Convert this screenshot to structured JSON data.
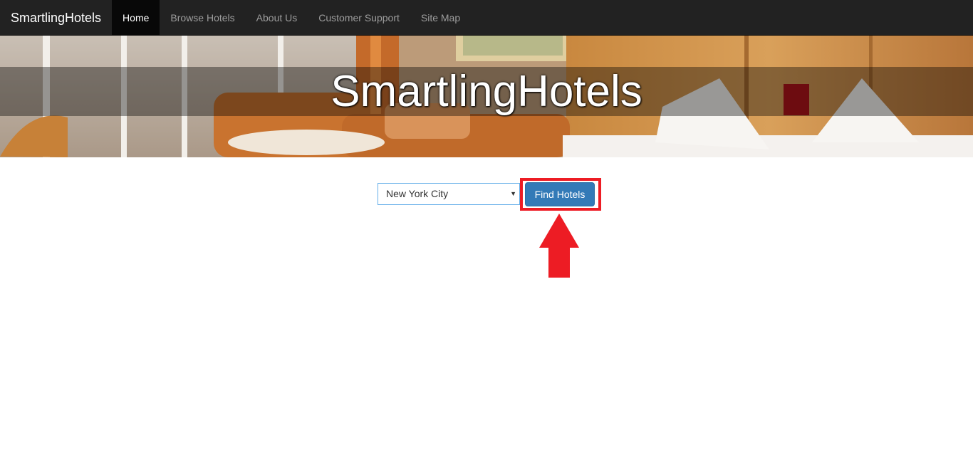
{
  "navbar": {
    "brand": "SmartlingHotels",
    "items": [
      {
        "label": "Home",
        "active": true
      },
      {
        "label": "Browse Hotels",
        "active": false
      },
      {
        "label": "About Us",
        "active": false
      },
      {
        "label": "Customer Support",
        "active": false
      },
      {
        "label": "Site Map",
        "active": false
      }
    ]
  },
  "hero": {
    "title": "SmartlingHotels"
  },
  "search": {
    "selected_city": "New York City",
    "button_label": "Find Hotels"
  },
  "colors": {
    "navbar_bg": "#222222",
    "primary_button": "#337ab7",
    "annotation_red": "#ed1c24"
  }
}
